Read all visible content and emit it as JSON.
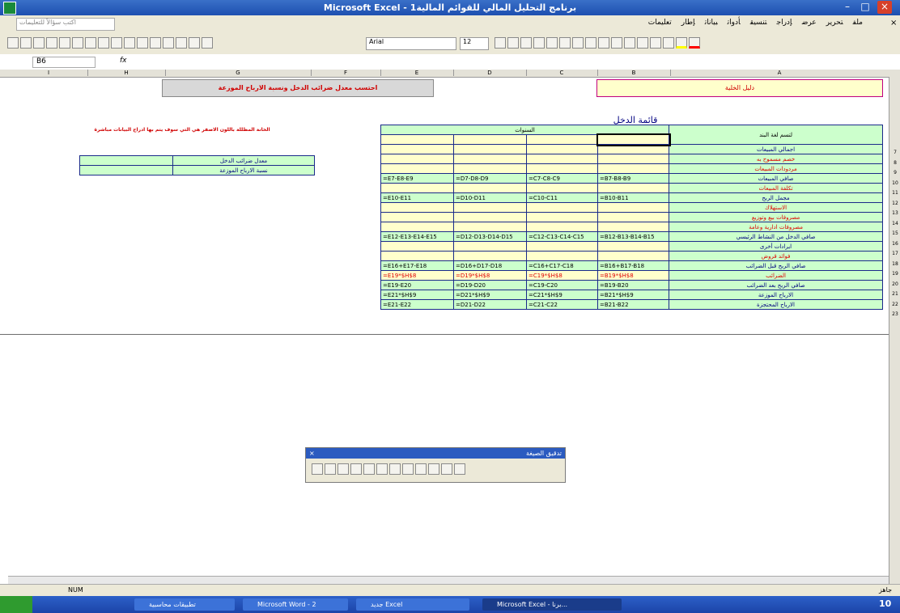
{
  "window": {
    "title": "Microsoft Excel - برنامج التحليل المالي للقوائم المالية1"
  },
  "menubar": {
    "items": [
      "ملف",
      "تحرير",
      "عرض",
      "إدراج",
      "تنسيق",
      "أدوات",
      "بيانات",
      "إطار",
      "تعليمات"
    ],
    "ask_placeholder": "اكتب سؤالاً للتعليمات"
  },
  "toolbar": {
    "font": "Arial",
    "size": "12"
  },
  "formula_bar": {
    "name_box": "B6",
    "fx": "fx",
    "content": ""
  },
  "columns": [
    "I",
    "H",
    "G",
    "F",
    "E",
    "D",
    "C",
    "B",
    "A"
  ],
  "sheet": {
    "title_cell": "قائمة الدخل",
    "header_box": "دليل الخلية",
    "banner": "احتسب معدل ضرائب الدخل ونسبة الارباح الموزعة",
    "note": "الخانة المظللة باللون الاصفر هي التي سوف يتم بها ادراج البيانات مباشرة",
    "years_label": "السنوات",
    "first_col_header": "لتسم لغة البند",
    "rows": [
      {
        "n": "7",
        "label": "اجمالي المبيعات",
        "vals": [
          "",
          "",
          "",
          ""
        ],
        "style": "yellow"
      },
      {
        "n": "8",
        "label": "خصم مسموح به",
        "vals": [
          "",
          "",
          "",
          ""
        ],
        "style": "yellow",
        "red": true
      },
      {
        "n": "9",
        "label": "مردودات المبيعات",
        "vals": [
          "",
          "",
          "",
          ""
        ],
        "style": "yellow",
        "red": true
      },
      {
        "n": "10",
        "label": "صافي المبيعات",
        "vals": [
          "=E7-E8-E9",
          "=D7-D8-D9",
          "=C7-C8-C9",
          "=B7-B8-B9"
        ],
        "style": "green"
      },
      {
        "n": "11",
        "label": "تكلفة المبيعات",
        "vals": [
          "",
          "",
          "",
          ""
        ],
        "style": "yellow",
        "red": true
      },
      {
        "n": "12",
        "label": "مجمل الربح",
        "vals": [
          "=E10-E11",
          "=D10-D11",
          "=C10-C11",
          "=B10-B11"
        ],
        "style": "green"
      },
      {
        "n": "13",
        "label": "الاستهلاك",
        "vals": [
          "",
          "",
          "",
          ""
        ],
        "style": "yellow",
        "red": true
      },
      {
        "n": "14",
        "label": "مصروفات بيع وتوزيع",
        "vals": [
          "",
          "",
          "",
          ""
        ],
        "style": "yellow",
        "red": true
      },
      {
        "n": "15",
        "label": "مصروفات ادارية وعامة",
        "vals": [
          "",
          "",
          "",
          ""
        ],
        "style": "yellow",
        "red": true
      },
      {
        "n": "16",
        "label": "صافي الدخل من النشاط الرئيسي",
        "vals": [
          "=E12-E13-E14-E15",
          "=D12-D13-D14-D15",
          "=C12-C13-C14-C15",
          "=B12-B13-B14-B15"
        ],
        "style": "green"
      },
      {
        "n": "17",
        "label": "ايرادات أخرى",
        "vals": [
          "",
          "",
          "",
          ""
        ],
        "style": "yellow"
      },
      {
        "n": "18",
        "label": "فوائد قروض",
        "vals": [
          "",
          "",
          "",
          ""
        ],
        "style": "yellow",
        "red": true
      },
      {
        "n": "19",
        "label": "صافي الربح قبل الضرائب",
        "vals": [
          "=E16+E17-E18",
          "=D16+D17-D18",
          "=C16+C17-C18",
          "=B16+B17-B18"
        ],
        "style": "green"
      },
      {
        "n": "20",
        "label": "الضرائب",
        "vals": [
          "=E19*$H$8",
          "=D19*$H$8",
          "=C19*$H$8",
          "=B19*$H$8"
        ],
        "style": "yellow",
        "red": true,
        "valred": true
      },
      {
        "n": "21",
        "label": "صافي الربح بعد الضرائب",
        "vals": [
          "=E19-E20",
          "=D19-D20",
          "=C19-C20",
          "=B19-B20"
        ],
        "style": "green"
      },
      {
        "n": "22",
        "label": "الارباح الموزعة",
        "vals": [
          "=E21*$H$9",
          "=D21*$H$9",
          "=C21*$H$9",
          "=B21*$H$9"
        ],
        "style": "green"
      },
      {
        "n": "23",
        "label": "الارباح المحتجزة",
        "vals": [
          "=E21-E22",
          "=D21-D22",
          "=C21-C22",
          "=B21-B22"
        ],
        "style": "green"
      }
    ],
    "rates": [
      {
        "label": "معدل ضرائب الدخل",
        "value": ""
      },
      {
        "label": "نسبة الارباح الموزعة",
        "value": ""
      }
    ]
  },
  "floating_toolbar": {
    "title": "تدقيق الصيغة"
  },
  "statusbar": {
    "mode": "NUM",
    "ready": "جاهز"
  },
  "taskbar": {
    "buttons": [
      "تطبيقات محاسبية",
      "Microsoft Word - 2",
      "جديد Excel",
      "Microsoft Excel - برنا..."
    ],
    "clock": "10"
  }
}
